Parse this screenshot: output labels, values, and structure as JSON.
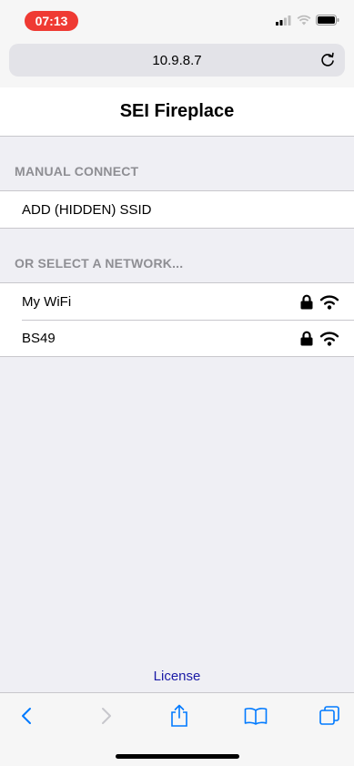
{
  "status_bar": {
    "time": "07:13"
  },
  "browser": {
    "url": "10.9.8.7"
  },
  "page": {
    "title": "SEI Fireplace",
    "manual_section": {
      "header": "MANUAL CONNECT",
      "items": [
        {
          "label": "ADD (HIDDEN) SSID"
        }
      ]
    },
    "network_section": {
      "header": "OR SELECT A NETWORK...",
      "items": [
        {
          "label": "My WiFi",
          "locked": true,
          "icons": [
            "lock-icon",
            "wifi-icon"
          ]
        },
        {
          "label": "BS49",
          "locked": true,
          "icons": [
            "lock-icon",
            "wifi-icon"
          ]
        }
      ]
    },
    "footer_link": "License"
  },
  "toolbar": {
    "buttons": [
      "back",
      "forward",
      "share",
      "bookmarks",
      "tabs"
    ]
  },
  "colors": {
    "status_pill": "#ef3a33",
    "link": "#1a1aa6",
    "toolbar_accent": "#007aff"
  }
}
